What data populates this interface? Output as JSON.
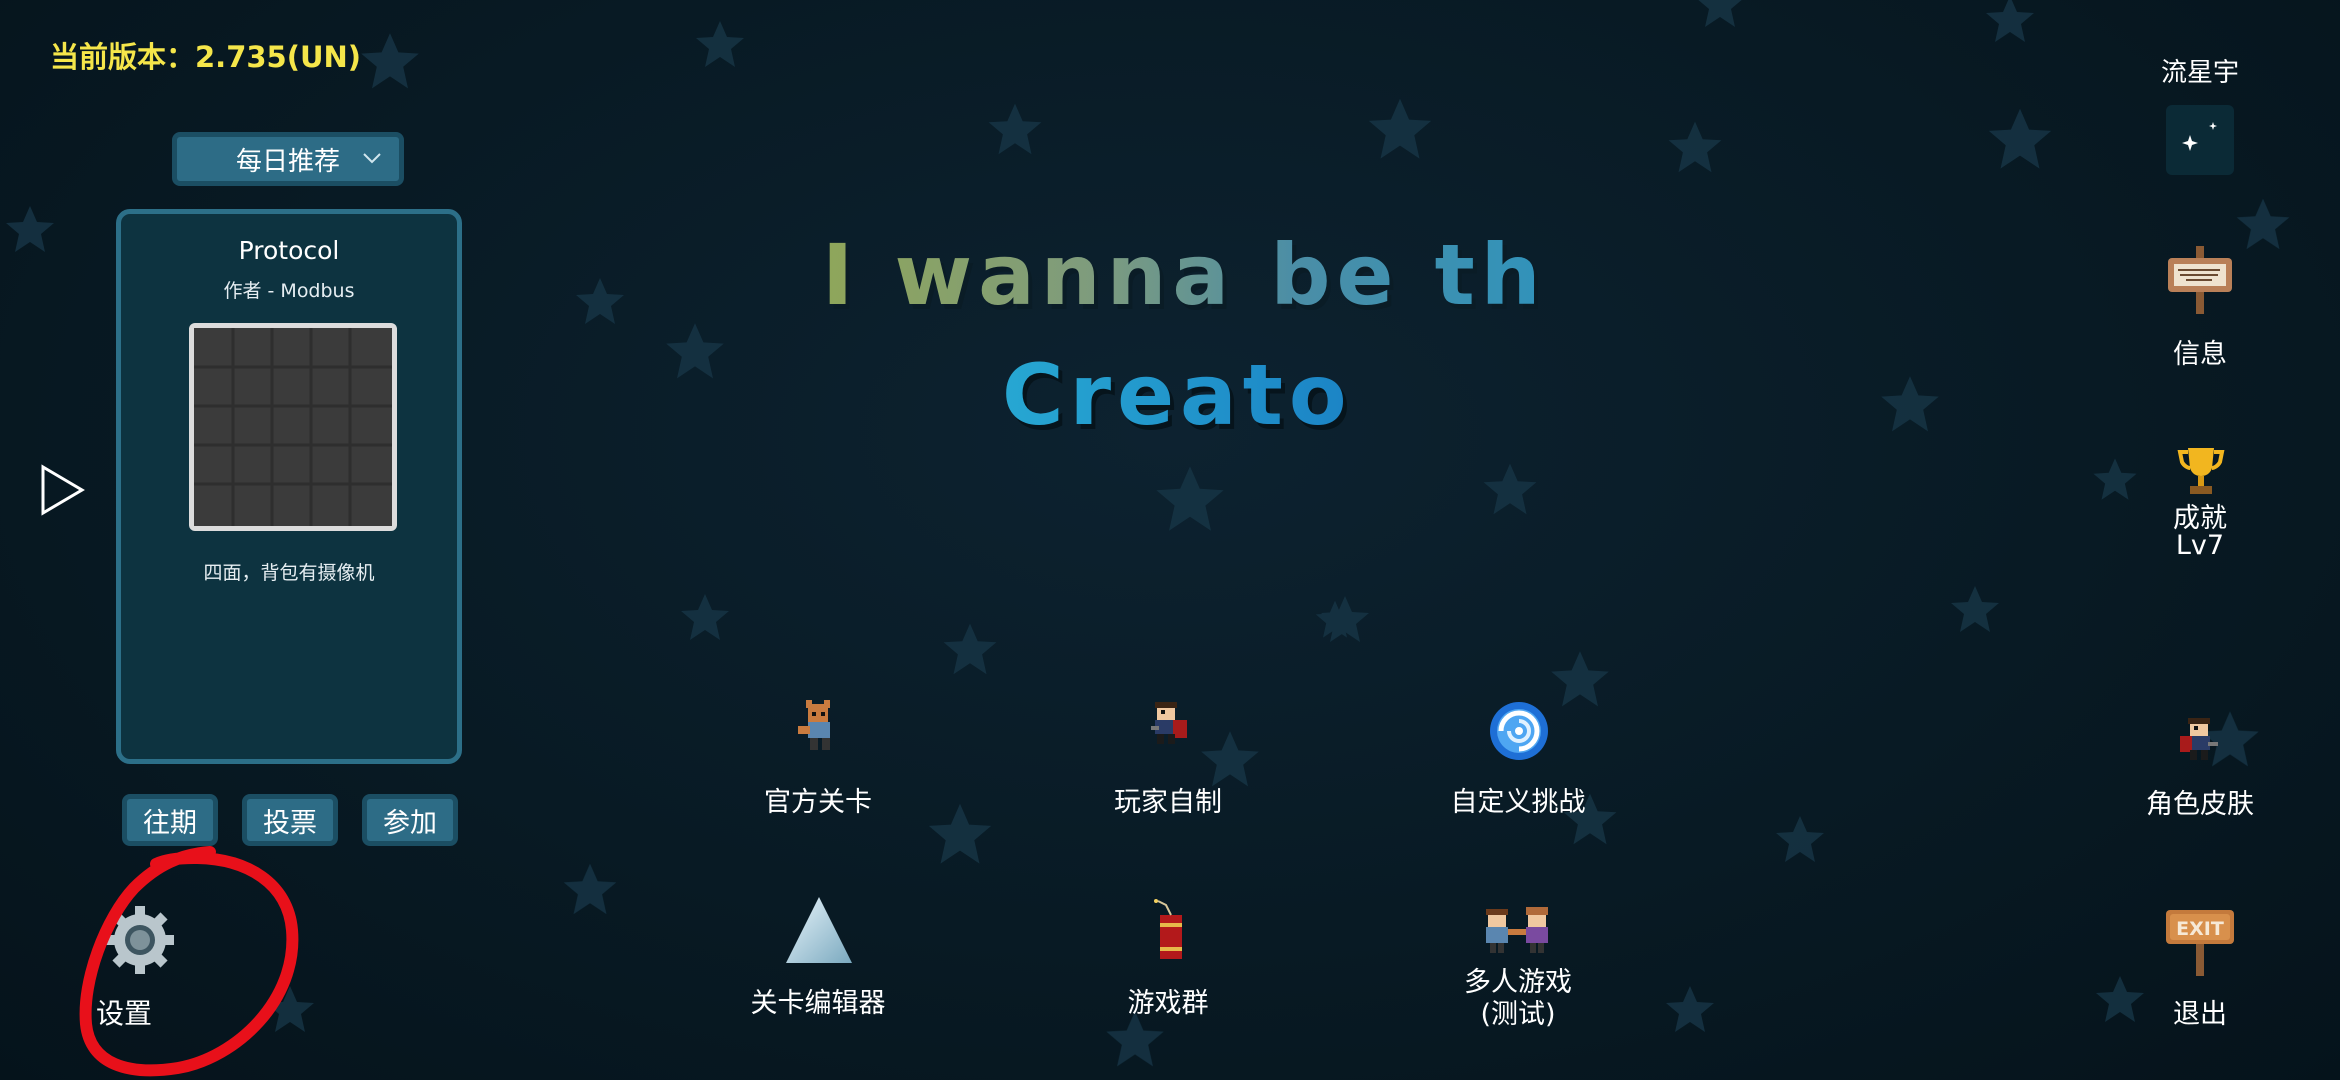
{
  "version_text": "当前版本：2.735(UN)",
  "daily": {
    "label": "每日推荐"
  },
  "card": {
    "title": "Protocol",
    "author": "作者 - Modbus",
    "description": "四面，背包有摄像机"
  },
  "card_buttons": [
    "往期",
    "投票",
    "参加"
  ],
  "title": {
    "line1": "I wanna be the",
    "line2": "Creator"
  },
  "menu": {
    "official": "官方关卡",
    "player_made": "玩家自制",
    "custom_challenge": "自定义挑战",
    "level_editor": "关卡编辑器",
    "game_group": "游戏群",
    "multiplayer_line1": "多人游戏",
    "multiplayer_line2": "(测试)"
  },
  "right": {
    "user_name": "流星宇",
    "info": "信息",
    "achievements": "成就",
    "level": "Lv7",
    "skins": "角色皮肤",
    "exit": "退出",
    "exit_sign_text": "EXIT"
  },
  "settings": {
    "label": "设置"
  },
  "colors": {
    "version": "#f5e64a",
    "panel_bg": "#0d3340",
    "panel_border": "#2c6f88",
    "button_bg": "#2d6c86",
    "annotation_red": "#e8101a"
  }
}
